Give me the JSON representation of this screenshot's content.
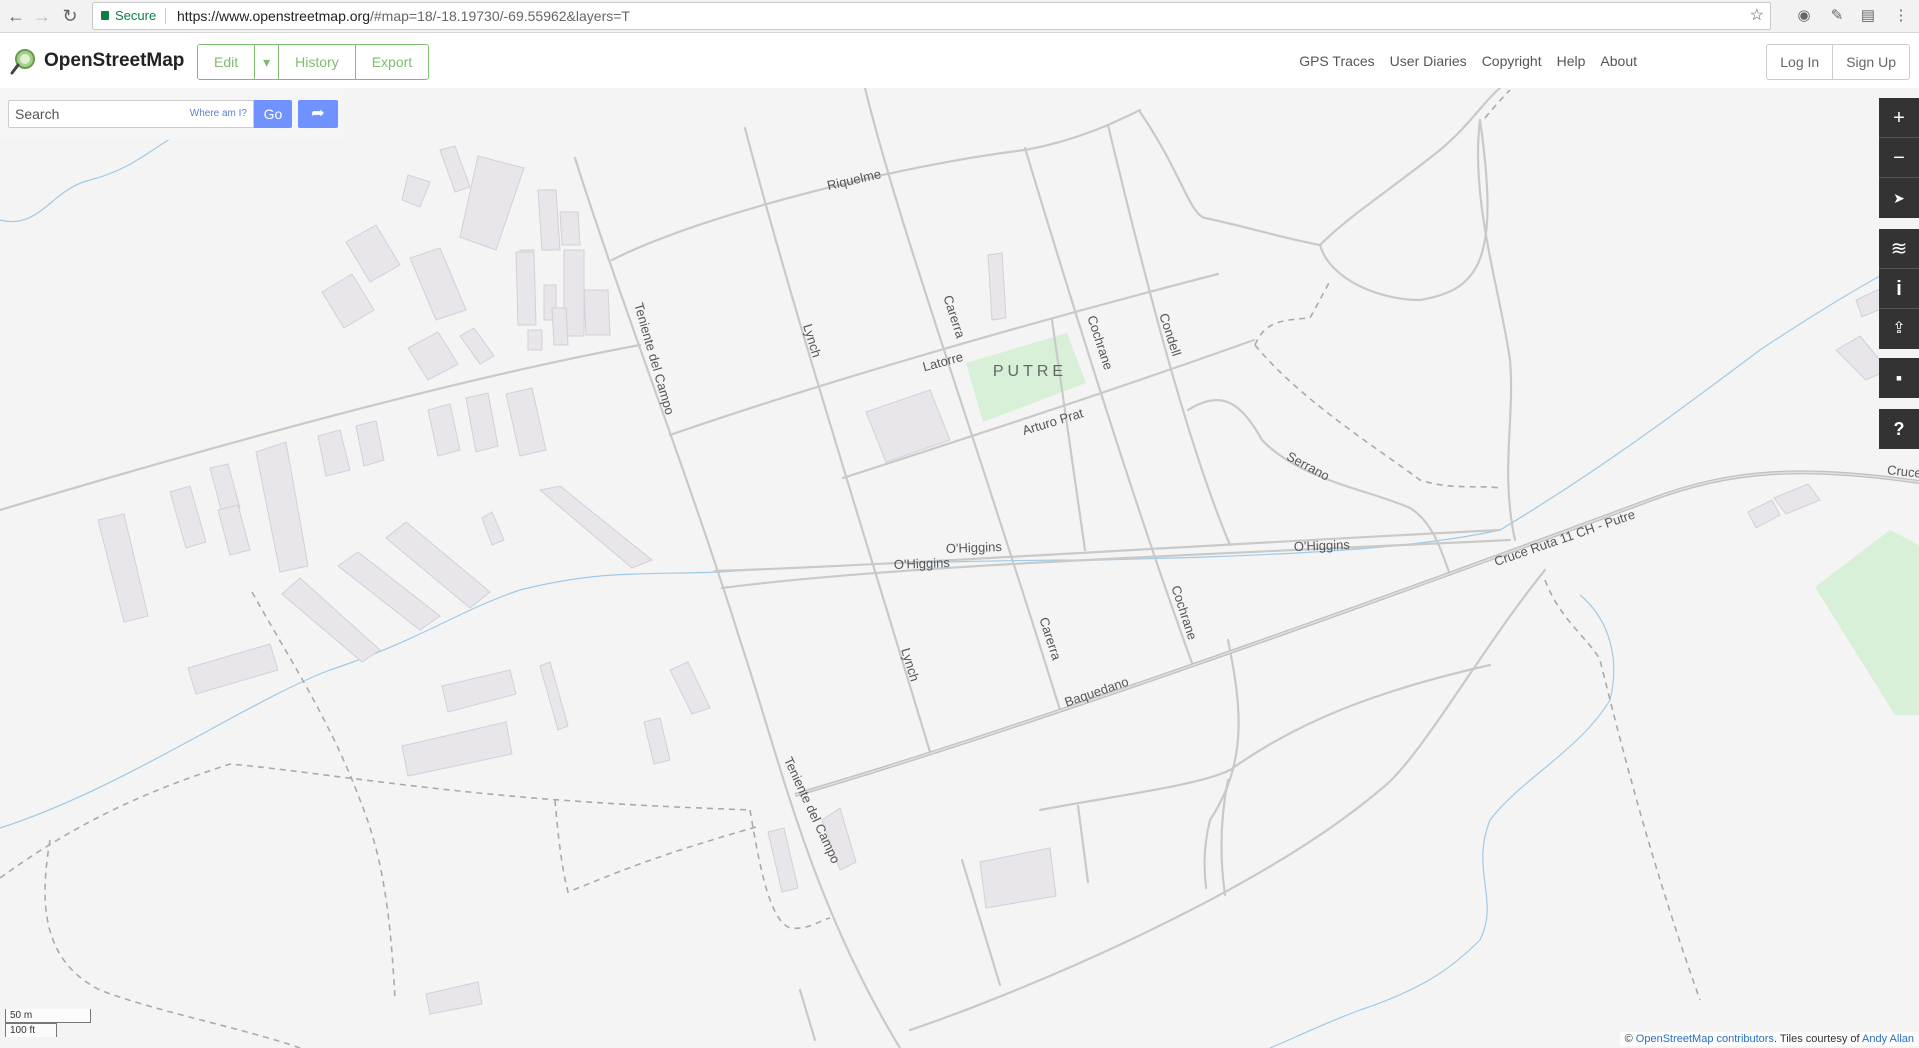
{
  "browser": {
    "secure_label": "Secure",
    "url_host": "https://www.openstreetmap.org",
    "url_rest": "/#map=18/-18.19730/-69.55962&layers=T"
  },
  "header": {
    "brand": "OpenStreetMap",
    "edit": "Edit",
    "edit_caret": "▾",
    "history": "History",
    "export": "Export",
    "nav": [
      "GPS Traces",
      "User Diaries",
      "Copyright",
      "Help",
      "About"
    ],
    "login": "Log In",
    "signup": "Sign Up"
  },
  "search": {
    "placeholder": "Search",
    "where_am_i": "Where am I?",
    "go": "Go"
  },
  "map": {
    "town": "PUTRE",
    "streets": {
      "riquelme": "Riquelme",
      "teniente1": "Teniente del Campo",
      "teniente2": "Teniente del Campo",
      "lynch1": "Lynch",
      "lynch2": "Lynch",
      "carerra1": "Carerra",
      "carerra2": "Carerra",
      "cochrane1": "Cochrane",
      "cochrane2": "Cochrane",
      "condell": "Condell",
      "latorre": "Latorre",
      "arturo": "Arturo Prat",
      "serrano": "Serrano",
      "ohiggins1": "O'Higgins",
      "ohiggins2": "O'Higgins",
      "ohiggins3": "O'Higgins",
      "baquedano": "Baquedano",
      "cruce": "Cruce Ruta 11 CH - Putre",
      "cruce_edge": "Cruce"
    },
    "colors": {
      "park": "#d7f0d7",
      "water": "#9ecae8",
      "road": "#c9c9c9",
      "building": "#e8e6ea"
    }
  },
  "controls": {
    "zoom_in": "+",
    "zoom_out": "−",
    "locate": "➤",
    "layers": "≋",
    "info": "i",
    "share": "⇪",
    "note": "▪",
    "help": "?"
  },
  "scale": {
    "metric": "50 m",
    "imperial": "100 ft"
  },
  "attribution": {
    "prefix": "©",
    "contributors": "OpenStreetMap contributors",
    "mid": ". Tiles courtesy of",
    "author": "Andy Allan"
  }
}
